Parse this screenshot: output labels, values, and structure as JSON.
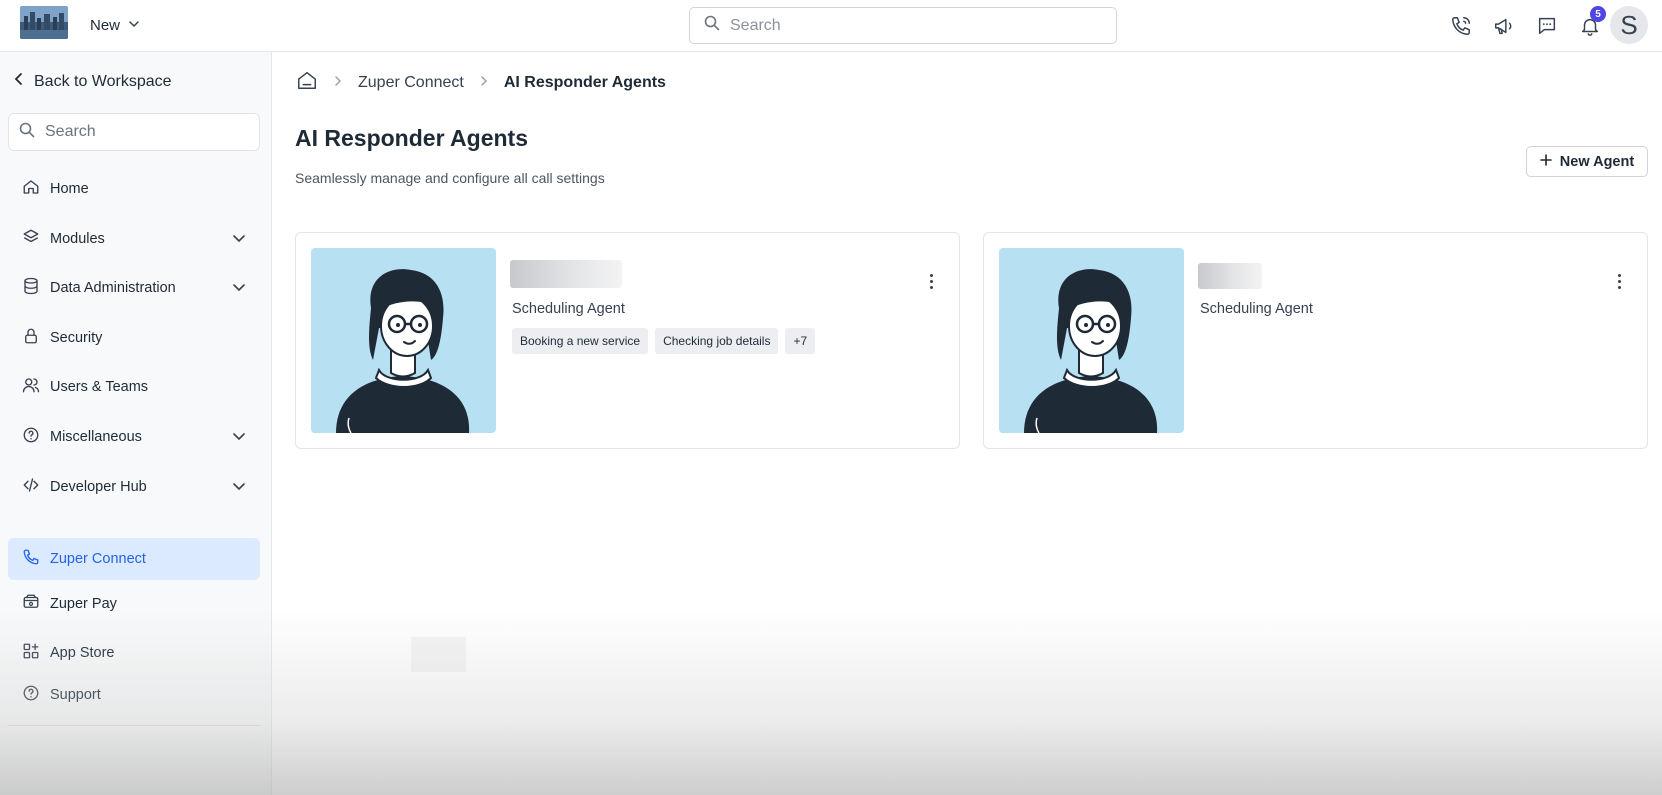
{
  "topbar": {
    "new_label": "New",
    "search_placeholder": "Search",
    "notification_count": "5",
    "avatar_initial": "S"
  },
  "sidebar": {
    "back_label": "Back to Workspace",
    "search_placeholder": "Search",
    "items": [
      {
        "label": "Home",
        "icon": "home-icon",
        "expandable": false,
        "active": false
      },
      {
        "label": "Modules",
        "icon": "layers-icon",
        "expandable": true,
        "active": false
      },
      {
        "label": "Data Administration",
        "icon": "database-icon",
        "expandable": true,
        "active": false
      },
      {
        "label": "Security",
        "icon": "lock-icon",
        "expandable": false,
        "active": false
      },
      {
        "label": "Users & Teams",
        "icon": "users-icon",
        "expandable": false,
        "active": false
      },
      {
        "label": "Miscellaneous",
        "icon": "help-circle-icon",
        "expandable": true,
        "active": false
      },
      {
        "label": "Developer Hub",
        "icon": "code-icon",
        "expandable": true,
        "active": false
      },
      {
        "label": "Zuper Connect",
        "icon": "phone-icon",
        "expandable": false,
        "active": true
      },
      {
        "label": "Zuper Pay",
        "icon": "wallet-icon",
        "expandable": false,
        "active": false
      },
      {
        "label": "App Store",
        "icon": "grid-plus-icon",
        "expandable": false,
        "active": false
      },
      {
        "label": "Support",
        "icon": "help-circle-icon",
        "expandable": false,
        "active": false
      }
    ]
  },
  "breadcrumb": {
    "items": [
      "Zuper Connect",
      "AI Responder Agents"
    ]
  },
  "page": {
    "title": "AI Responder Agents",
    "subtitle": "Seamlessly manage and configure all call settings",
    "new_agent_label": "New Agent"
  },
  "agents": [
    {
      "role": "Scheduling Agent",
      "tags": [
        "Booking a new service",
        "Checking job details",
        "+7"
      ]
    },
    {
      "role": "Scheduling Agent",
      "tags": []
    }
  ],
  "colors": {
    "accent": "#2563eb",
    "active_bg": "#dbeafe",
    "badge": "#4f46e5",
    "portrait_bg": "#b8e0f3"
  }
}
